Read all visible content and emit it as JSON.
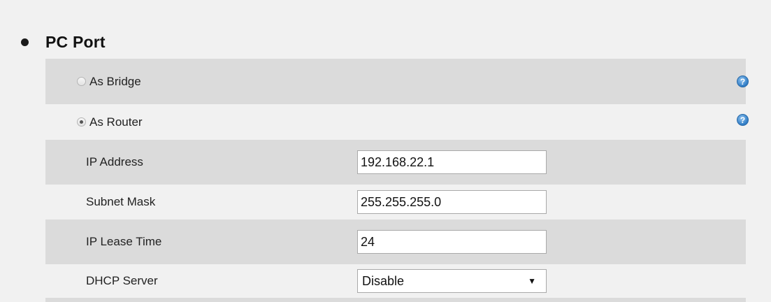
{
  "section": {
    "title": "PC Port"
  },
  "mode_options": [
    {
      "label": "As Bridge",
      "checked": false
    },
    {
      "label": "As Router",
      "checked": true
    }
  ],
  "help_icon": {
    "glyph": "?",
    "icon": "help-icon",
    "color": "#2f7cc5"
  },
  "fields": {
    "ip_address": {
      "label": "IP Address",
      "value": "192.168.22.1"
    },
    "subnet_mask": {
      "label": "Subnet Mask",
      "value": "255.255.255.0"
    },
    "ip_lease_time": {
      "label": "IP Lease Time",
      "value": "24"
    },
    "dhcp_server": {
      "label": "DHCP Server",
      "selected": "Disable",
      "arrow": "▼"
    }
  },
  "colors": {
    "shaded_row": "#dbdbdb",
    "background": "#f1f1f1"
  }
}
